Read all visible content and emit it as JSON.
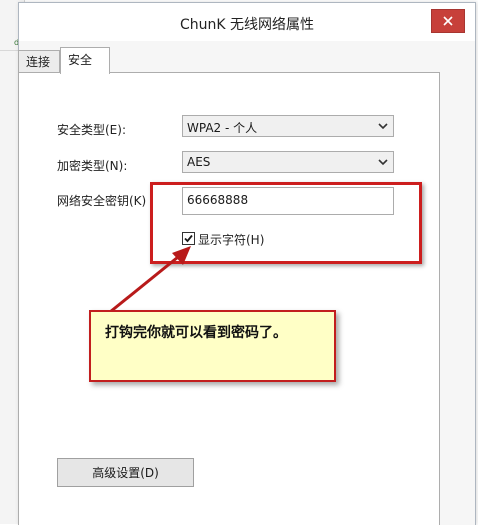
{
  "window": {
    "title": "ChunK 无线网络属性"
  },
  "background": {
    "fragment": "dB"
  },
  "tabs": [
    {
      "label": "连接",
      "active": false
    },
    {
      "label": "安全",
      "active": true
    }
  ],
  "security": {
    "type_label": "安全类型(E):",
    "type_value": "WPA2 - 个人",
    "encryption_label": "加密类型(N):",
    "encryption_value": "AES",
    "key_label": "网络安全密钥(K)",
    "key_value": "66668888",
    "show_chars_label": "显示字符(H)",
    "show_chars_checked": true
  },
  "annotation": {
    "callout_text": "打钩完你就可以看到密码了。",
    "highlight_color": "#cc1e1e",
    "callout_bg": "#ffffc6"
  },
  "buttons": {
    "advanced": "高级设置(D)"
  },
  "colors": {
    "close_button": "#c7403a"
  }
}
